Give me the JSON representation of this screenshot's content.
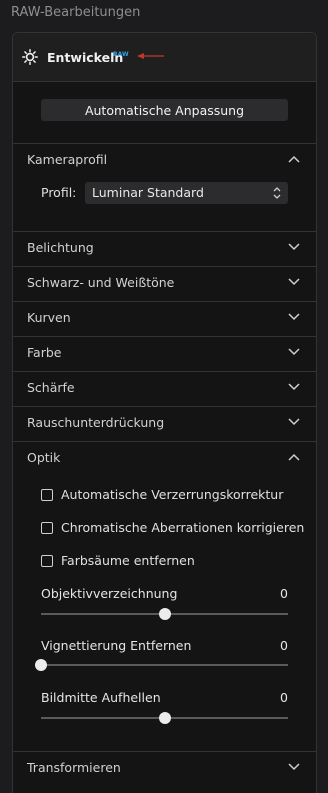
{
  "header": {
    "title": "RAW-Bearbeitungen"
  },
  "develop": {
    "title": "Entwickeln",
    "badge": "RAW",
    "icon": "sun-icon",
    "accent": "#35a0e0",
    "arrow_color": "#c0392b"
  },
  "auto_button": {
    "label": "Automatische Anpassung"
  },
  "camera_profile": {
    "title": "Kameraprofil",
    "profile_label": "Profil:",
    "profile_value": "Luminar Standard"
  },
  "sections": {
    "exposure": "Belichtung",
    "blacks_whites": "Schwarz- und Weißtöne",
    "curves": "Kurven",
    "color": "Farbe",
    "sharpness": "Schärfe",
    "noise": "Rauschunterdrückung",
    "optics": "Optik",
    "transform": "Transformieren"
  },
  "optics": {
    "checkboxes": [
      {
        "label": "Automatische Verzerrungskorrektur",
        "checked": false
      },
      {
        "label": "Chromatische Aberrationen korrigieren",
        "checked": false
      },
      {
        "label": "Farbsäume entfernen",
        "checked": false
      }
    ],
    "sliders": [
      {
        "label": "Objektivverzeichnung",
        "value": "0",
        "position": 0.5
      },
      {
        "label": "Vignettierung Entfernen",
        "value": "0",
        "position": 0.0
      },
      {
        "label": "Bildmitte Aufhellen",
        "value": "0",
        "position": 0.5
      }
    ]
  }
}
